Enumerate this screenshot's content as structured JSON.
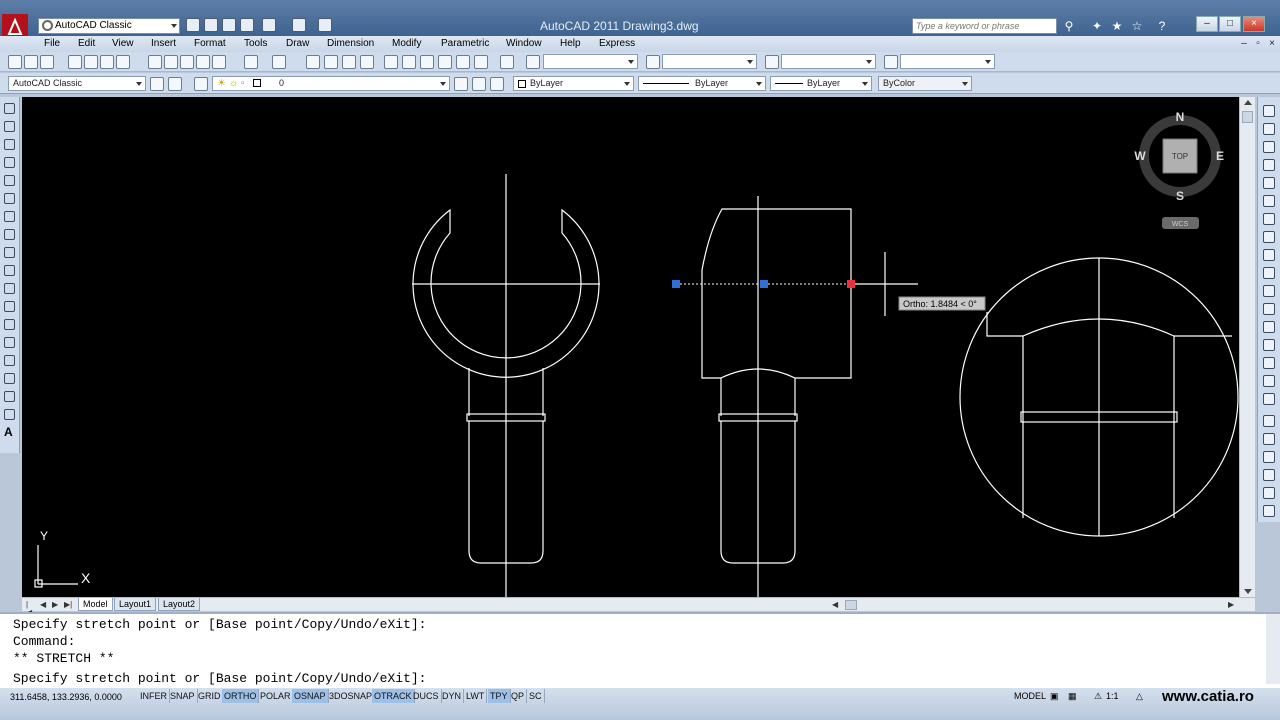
{
  "title_bar": {
    "workspace": "AutoCAD Classic",
    "app_title": "AutoCAD 2011    Drawing3.dwg",
    "search_placeholder": "Type a keyword or phrase",
    "minimize": "–",
    "restore": "□",
    "close": "×"
  },
  "menu": {
    "items": [
      "File",
      "Edit",
      "View",
      "Insert",
      "Format",
      "Tools",
      "Draw",
      "Dimension",
      "Modify",
      "Parametric",
      "Window",
      "Help",
      "Express"
    ]
  },
  "toolbar2": {
    "workspace_combo": "AutoCAD Classic",
    "layer_combo": "0",
    "color_combo": "ByLayer",
    "linetype_combo": "ByLayer",
    "lineweight_combo": "ByLayer",
    "plotstyle_combo": "ByColor"
  },
  "viewcube": {
    "north": "N",
    "south": "S",
    "east": "E",
    "west": "W",
    "face": "TOP",
    "wcs": "WCS"
  },
  "canvas": {
    "tooltip": "Ortho: 1.8484 < 0°",
    "ucs_x": "X",
    "ucs_y": "Y"
  },
  "tabs": {
    "items": [
      "Model",
      "Layout1",
      "Layout2"
    ],
    "active": "Model"
  },
  "command_window": {
    "lines": [
      "Specify stretch point or [Base point/Copy/Undo/eXit]:",
      "Command:",
      "** STRETCH **",
      "Specify stretch point or [Base point/Copy/Undo/eXit]:"
    ]
  },
  "status_bar": {
    "coordinates": "311.6458, 133.2936, 0.0000",
    "toggles": [
      {
        "label": "INFER",
        "on": false
      },
      {
        "label": "SNAP",
        "on": false
      },
      {
        "label": "GRID",
        "on": false
      },
      {
        "label": "ORTHO",
        "on": true
      },
      {
        "label": "POLAR",
        "on": false
      },
      {
        "label": "OSNAP",
        "on": true
      },
      {
        "label": "3DOSNAP",
        "on": false
      },
      {
        "label": "OTRACK",
        "on": true
      },
      {
        "label": "DUCS",
        "on": false
      },
      {
        "label": "DYN",
        "on": false
      },
      {
        "label": "LWT",
        "on": false
      },
      {
        "label": "TPY",
        "on": true
      },
      {
        "label": "QP",
        "on": false
      },
      {
        "label": "SC",
        "on": false
      }
    ],
    "model_label": "MODEL",
    "scale": "1:1",
    "watermark": "www.catia.ro"
  },
  "colors": {
    "canvas_bg": "#000000",
    "grip_selected": "#e8323c",
    "grip_unselected": "#2f6fd6",
    "toggle_on": "#9cc0e8"
  }
}
